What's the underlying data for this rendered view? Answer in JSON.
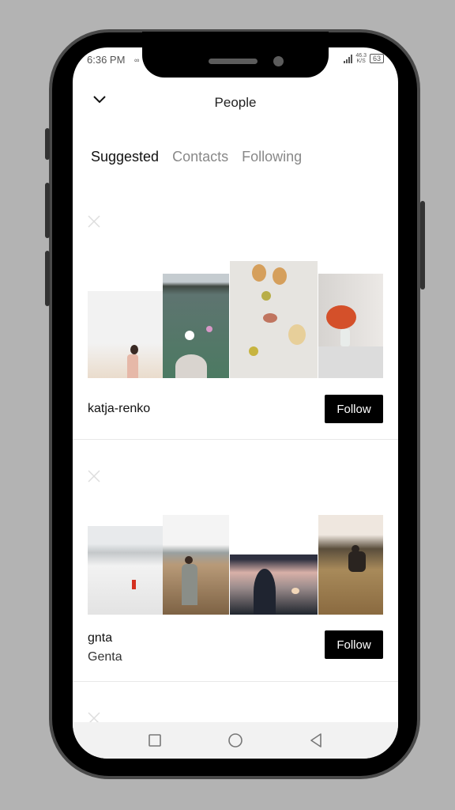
{
  "status_bar": {
    "time": "6:36 PM",
    "left_icon": "∞",
    "net_speed_value": "46.3",
    "net_speed_unit": "K/S",
    "battery": "63"
  },
  "header": {
    "back_icon": "chevron-down-icon",
    "title": "People"
  },
  "tabs": [
    {
      "label": "Suggested",
      "active": true
    },
    {
      "label": "Contacts",
      "active": false
    },
    {
      "label": "Following",
      "active": false
    }
  ],
  "suggestions": [
    {
      "username": "katja-renko",
      "display_name": "",
      "follow_label": "Follow",
      "photos": [
        "beach-girl",
        "flowers-lake",
        "dried-fruits-flowers",
        "red-tulips"
      ]
    },
    {
      "username": "gnta",
      "display_name": "Genta",
      "follow_label": "Follow",
      "photos": [
        "snowy-landscape",
        "person-in-grass",
        "sunset-silhouette",
        "field-sitting"
      ]
    }
  ],
  "nav_bar": {
    "recent_icon": "square-icon",
    "home_icon": "circle-icon",
    "back_icon": "triangle-back-icon"
  }
}
